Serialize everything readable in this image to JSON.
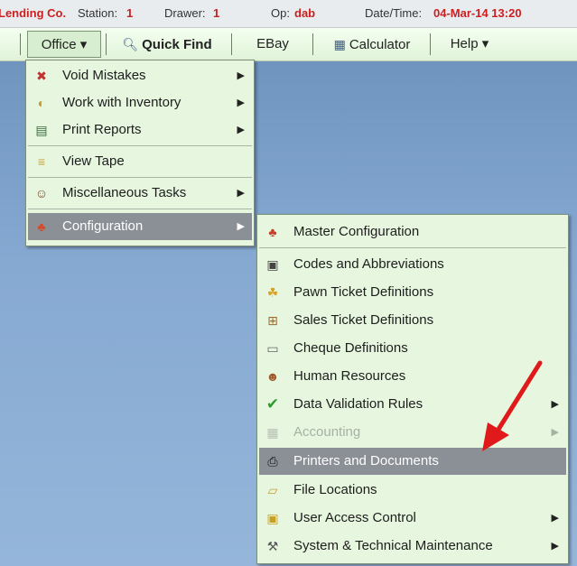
{
  "status_bar": {
    "company": "Lending Co.",
    "station_label": "Station:",
    "station_value": "1",
    "drawer_label": "Drawer:",
    "drawer_value": "1",
    "op_label": "Op:",
    "op_value": "dab",
    "datetime_label": "Date/Time:",
    "datetime_value": "04-Mar-14 13:20"
  },
  "menubar": {
    "office": "Office ▾",
    "quick_find": "Quick Find",
    "ebay": "EBay",
    "calculator": "Calculator",
    "help": "Help ▾"
  },
  "office_menu": [
    {
      "label": "Void Mistakes",
      "icon": "void-mistakes-icon",
      "has_submenu": true
    },
    {
      "label": "Work with Inventory",
      "icon": "inventory-icon",
      "has_submenu": true
    },
    {
      "label": "Print Reports",
      "icon": "print-reports-icon",
      "has_submenu": true
    },
    {
      "label": "View Tape",
      "icon": "tape-icon",
      "has_submenu": false
    },
    {
      "label": "Miscellaneous Tasks",
      "icon": "person-icon",
      "has_submenu": true
    },
    {
      "label": "Configuration",
      "icon": "configuration-icon",
      "has_submenu": true,
      "highlighted": true
    }
  ],
  "config_menu": [
    {
      "label": "Master Configuration",
      "icon": "master-config-icon"
    },
    {
      "label": "Codes and Abbreviations",
      "icon": "codes-icon"
    },
    {
      "label": "Pawn Ticket Definitions",
      "icon": "pawn-ticket-icon"
    },
    {
      "label": "Sales Ticket Definitions",
      "icon": "cart-icon"
    },
    {
      "label": "Cheque Definitions",
      "icon": "cheque-icon"
    },
    {
      "label": "Human Resources",
      "icon": "people-icon"
    },
    {
      "label": "Data Validation Rules",
      "icon": "checkmark-icon",
      "has_submenu": true
    },
    {
      "label": "Accounting",
      "icon": "accounting-icon",
      "has_submenu": true,
      "disabled": true
    },
    {
      "label": "Printers and Documents",
      "icon": "printer-icon",
      "highlighted": true
    },
    {
      "label": "File Locations",
      "icon": "folder-icon"
    },
    {
      "label": "User Access Control",
      "icon": "lock-icon",
      "has_submenu": true
    },
    {
      "label": "System & Technical Maintenance",
      "icon": "tools-icon",
      "has_submenu": true
    }
  ],
  "colors": {
    "menu_bg": "#e7f7df",
    "highlight_bg": "#8b8f96",
    "desktop_bg": "#86a9d2",
    "status_red": "#cc1f1f",
    "annotation_arrow": "#e01a1a"
  }
}
